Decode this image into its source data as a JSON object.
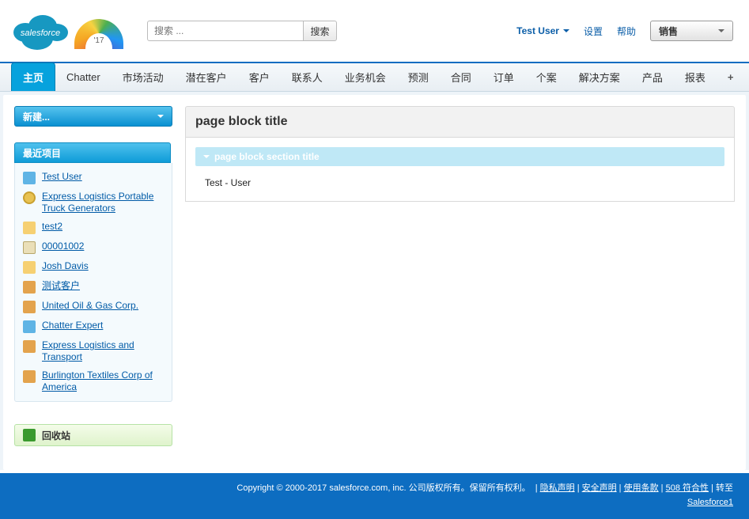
{
  "header": {
    "search_placeholder": "搜索 ...",
    "search_button": "搜索",
    "user_menu": "Test User",
    "settings": "设置",
    "help": "帮助",
    "app_name": "销售"
  },
  "tabs": [
    {
      "label": "主页",
      "active": true
    },
    {
      "label": "Chatter"
    },
    {
      "label": "市场活动"
    },
    {
      "label": "潜在客户"
    },
    {
      "label": "客户"
    },
    {
      "label": "联系人"
    },
    {
      "label": "业务机会"
    },
    {
      "label": "预测"
    },
    {
      "label": "合同"
    },
    {
      "label": "订单"
    },
    {
      "label": "个案"
    },
    {
      "label": "解决方案"
    },
    {
      "label": "产品"
    },
    {
      "label": "报表"
    }
  ],
  "sidebar": {
    "new_button": "新建...",
    "recent_header": "最近项目",
    "recent_items": [
      {
        "label": "Test User",
        "icon": "user"
      },
      {
        "label": "Express Logistics Portable Truck Generators",
        "icon": "opp"
      },
      {
        "label": "test2",
        "icon": "lead"
      },
      {
        "label": "00001002",
        "icon": "contract"
      },
      {
        "label": "Josh Davis",
        "icon": "lead"
      },
      {
        "label": "测试客户",
        "icon": "acct"
      },
      {
        "label": "United Oil & Gas Corp.",
        "icon": "acct"
      },
      {
        "label": "Chatter Expert",
        "icon": "user"
      },
      {
        "label": "Express Logistics and Transport",
        "icon": "acct"
      },
      {
        "label": "Burlington Textiles Corp of America",
        "icon": "acct"
      }
    ],
    "recycle_bin": "回收站"
  },
  "page_block": {
    "title": "page block title",
    "section_title": "page block section title",
    "row_value": "Test - User"
  },
  "footer": {
    "copyright": "Copyright © 2000-2017 salesforce.com, inc. 公司版权所有。保留所有权利。",
    "links": {
      "privacy": "隐私声明",
      "security": "安全声明",
      "terms": "使用条款",
      "accessibility": "508 符合性",
      "switch_prefix": "转至",
      "salesforce1": "Salesforce1"
    }
  }
}
